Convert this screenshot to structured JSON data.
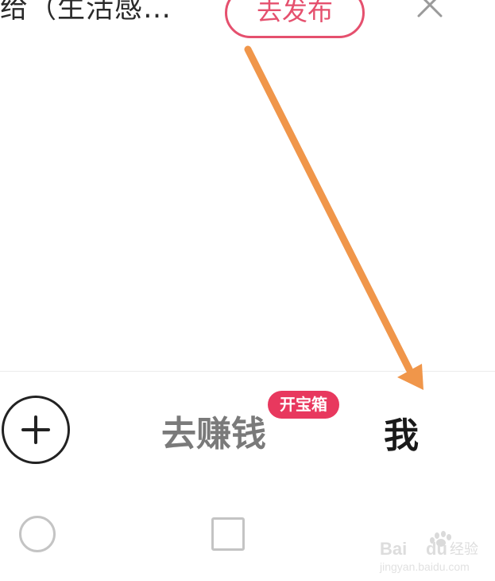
{
  "header": {
    "title": "给（生活感…",
    "publish_label": "去发布"
  },
  "tabbar": {
    "earn_label": "去赚钱",
    "badge_label": "开宝箱",
    "me_label": "我"
  },
  "icons": {
    "close": "close-icon",
    "plus": "plus-icon",
    "home": "home-icon",
    "recents": "recents-icon"
  },
  "colors": {
    "accent": "#e5506e",
    "badge": "#e8385e",
    "arrow": "#f0964a"
  },
  "watermark": {
    "text": "Bai du 经验",
    "url": "jingyan.baidu.com"
  }
}
